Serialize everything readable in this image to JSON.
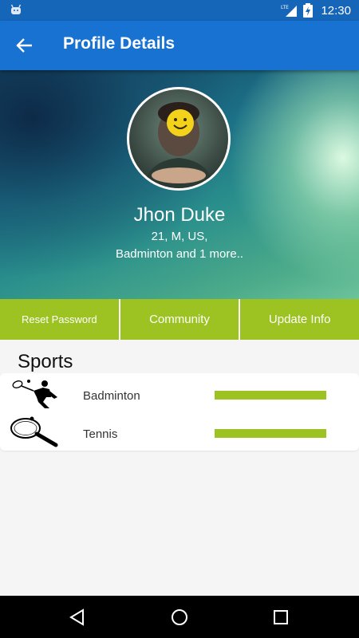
{
  "status_bar": {
    "network": "LTE",
    "time": "12:30",
    "icons": [
      "android-icon",
      "lte-signal-icon",
      "battery-charging-icon"
    ]
  },
  "toolbar": {
    "title": "Profile Details",
    "back_icon": "arrow-back-icon"
  },
  "profile": {
    "name": "Jhon Duke",
    "details": "21,  M,   US,",
    "sports_summary": "Badminton and 1 more.."
  },
  "actions": {
    "reset_password": "Reset Password",
    "community": "Community",
    "update_info": "Update Info"
  },
  "sports": {
    "title": "Sports",
    "items": [
      {
        "name": "Badminton",
        "icon": "badminton-player-icon",
        "level": 1.0
      },
      {
        "name": "Tennis",
        "icon": "tennis-racket-icon",
        "level": 1.0
      }
    ]
  },
  "colors": {
    "status_bar": "#1565b8",
    "toolbar": "#1872d1",
    "accent_green": "#9dc322"
  },
  "nav_bar": {
    "icons": [
      "back-triangle-icon",
      "home-circle-icon",
      "recents-square-icon"
    ]
  }
}
